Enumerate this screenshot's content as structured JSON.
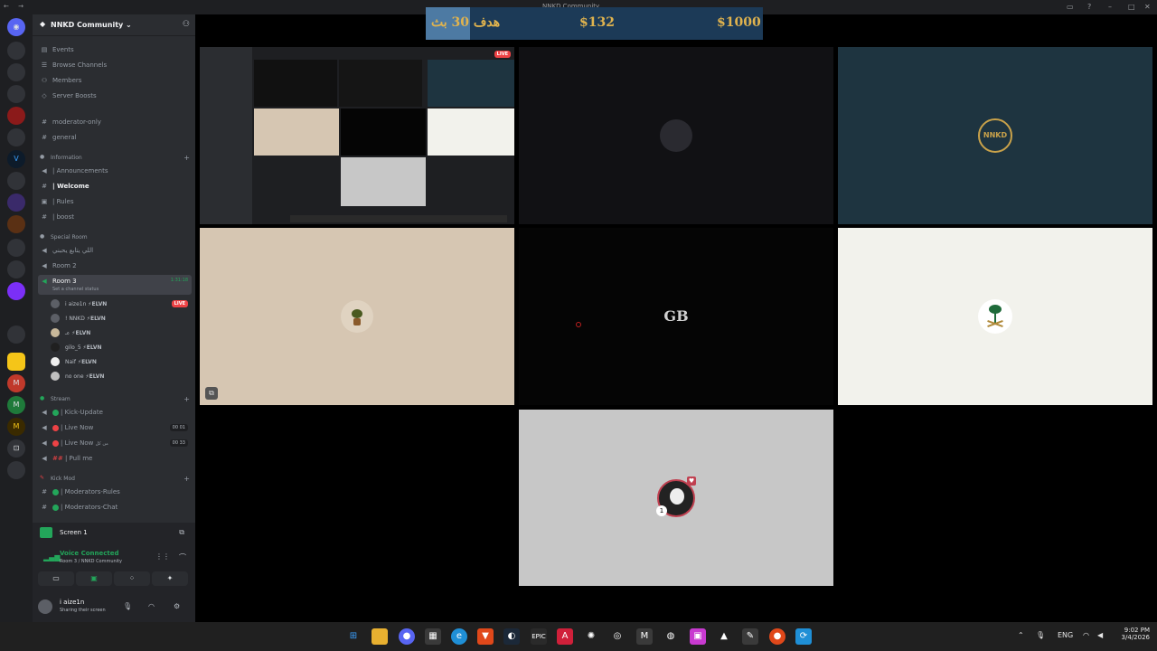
{
  "titlebar": {
    "title": "NNKD Community",
    "nav": "← →"
  },
  "server": {
    "name": "NNKD Community",
    "chevron": "⌄"
  },
  "top_menu": [
    {
      "icon": "calendar-icon",
      "label": "Events"
    },
    {
      "icon": "browse-icon",
      "label": "Browse Channels"
    },
    {
      "icon": "members-icon",
      "label": "Members"
    },
    {
      "icon": "boost-icon",
      "label": "Server Boosts"
    }
  ],
  "channels_top": [
    {
      "label": "moderator-only"
    },
    {
      "label": "general"
    }
  ],
  "categories": {
    "information": "Information",
    "special": "Special Room",
    "stream": "Stream",
    "kickmod": "Kick Mod"
  },
  "information_channels": [
    {
      "label": "| Announcements"
    },
    {
      "label": "| Welcome"
    },
    {
      "label": "| Rules"
    },
    {
      "label": "| boost"
    }
  ],
  "special_channels": [
    {
      "label": "اللي يتابع يحبني"
    },
    {
      "label": "Room 2"
    },
    {
      "label": "Room 3",
      "status": "Set a channel status",
      "timer": "1:31:18"
    }
  ],
  "room3_members": [
    {
      "name": "i aize1n",
      "tag": "ELVN",
      "live": "LIVE"
    },
    {
      "name": "! NNKD",
      "tag": "ELVN"
    },
    {
      "name": "عـ",
      "tag": "ELVN"
    },
    {
      "name": "gilo_5",
      "tag": "ELVN"
    },
    {
      "name": "Naif",
      "tag": "ELVN"
    },
    {
      "name": "no one",
      "tag": "ELVN"
    }
  ],
  "stream_channels": [
    {
      "label": "| Kick-Update"
    },
    {
      "label": "| Live Now",
      "count": "00 01"
    },
    {
      "label": "| Live Now",
      "suffix": "من كل",
      "count": "00 33"
    },
    {
      "label": "| Pull me"
    }
  ],
  "kickmod_channels": [
    {
      "label": "| Moderators-Rules"
    },
    {
      "label": "| Moderators-Chat"
    }
  ],
  "screen_panel": {
    "title": "Screen 1"
  },
  "voice": {
    "status": "Voice Connected",
    "channel": "Room 3 / NNKD Community"
  },
  "user": {
    "name": "i aize1n",
    "status": "Sharing their screen"
  },
  "goal": {
    "label": "هدف 30 بث",
    "current": "$132",
    "target": "$1000",
    "progress": 0.132,
    "text_color": "#e0b34e",
    "bar_color": "#1c3a57",
    "fill_color": "#4d7aa3"
  },
  "tiles": [
    {
      "name": "screen-share",
      "bg": "#1e1f22",
      "kind": "screen",
      "live": "LIVE"
    },
    {
      "name": "anime-avatar",
      "bg": "#111114",
      "kind": "avatar"
    },
    {
      "name": "nnkd-logo",
      "bg": "#1e3440",
      "kind": "logo",
      "text": "NNKD"
    },
    {
      "name": "plant-avatar",
      "bg": "#d6c6b2",
      "kind": "avatar"
    },
    {
      "name": "gb-avatar",
      "bg": "#050505",
      "kind": "text",
      "text": "GB"
    },
    {
      "name": "saudi-emblem",
      "bg": "#f2f2ec",
      "kind": "avatar"
    },
    {
      "name": "profile-avatar",
      "bg": "#c7c7c7",
      "kind": "avatar"
    }
  ],
  "taskbar": {
    "lang": "ENG",
    "time": "9:02 PM",
    "date": "3/4/2026"
  }
}
